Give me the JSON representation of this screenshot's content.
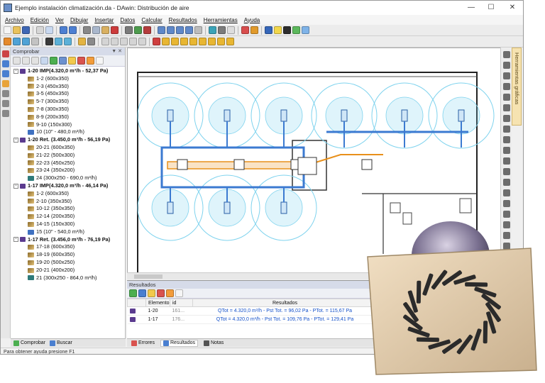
{
  "window": {
    "title": "Ejemplo instalación climatización.da - DAwin: Distribución de aire"
  },
  "menu": [
    "Archivo",
    "Edición",
    "Ver",
    "Dibujar",
    "Insertar",
    "Datos",
    "Calcular",
    "Resultados",
    "Herramientas",
    "Ayuda"
  ],
  "panel": {
    "title": "Comprobar",
    "tree": [
      {
        "level": 0,
        "icon": "sys",
        "label": "1-20 IMP(4.320,0 m³/h - 52,37 Pa)"
      },
      {
        "level": 1,
        "icon": "duct",
        "label": "1-2 (600x350)"
      },
      {
        "level": 1,
        "icon": "duct",
        "label": "2-3 (450x350)"
      },
      {
        "level": 1,
        "icon": "duct",
        "label": "3-5 (450x350)"
      },
      {
        "level": 1,
        "icon": "duct",
        "label": "5-7 (300x350)"
      },
      {
        "level": 1,
        "icon": "duct",
        "label": "7-8 (300x350)"
      },
      {
        "level": 1,
        "icon": "duct",
        "label": "8-9 (200x350)"
      },
      {
        "level": 1,
        "icon": "duct",
        "label": "9-10 (150x300)"
      },
      {
        "level": 1,
        "icon": "grille",
        "label": "10 (10\" - 480,0 m³/h)"
      },
      {
        "level": 0,
        "icon": "sys",
        "label": "1-20 Ret. (3.450,0 m³/h - 56,19 Pa)"
      },
      {
        "level": 1,
        "icon": "duct",
        "label": "20-21 (600x350)"
      },
      {
        "level": 1,
        "icon": "duct",
        "label": "21-22 (500x300)"
      },
      {
        "level": 1,
        "icon": "duct",
        "label": "22-23 (450x250)"
      },
      {
        "level": 1,
        "icon": "duct",
        "label": "23-24 (350x200)"
      },
      {
        "level": 1,
        "icon": "ret",
        "label": "24 (300x250 - 690,0 m³/h)"
      },
      {
        "level": 0,
        "icon": "sys",
        "label": "1-17 IMP(4.320,0 m³/h - 46,14 Pa)"
      },
      {
        "level": 1,
        "icon": "duct",
        "label": "1-2 (600x350)"
      },
      {
        "level": 1,
        "icon": "duct",
        "label": "2-10 (350x350)"
      },
      {
        "level": 1,
        "icon": "duct",
        "label": "10-12 (350x350)"
      },
      {
        "level": 1,
        "icon": "duct",
        "label": "12-14 (200x350)"
      },
      {
        "level": 1,
        "icon": "duct",
        "label": "14-15 (150x300)"
      },
      {
        "level": 1,
        "icon": "grille",
        "label": "15 (10\" - 540,0 m³/h)"
      },
      {
        "level": 0,
        "icon": "sys",
        "label": "1-17 Ret. (3.456,0 m³/h - 76,19 Pa)"
      },
      {
        "level": 1,
        "icon": "duct",
        "label": "17-18 (600x350)"
      },
      {
        "level": 1,
        "icon": "duct",
        "label": "18-19 (600x350)"
      },
      {
        "level": 1,
        "icon": "duct",
        "label": "19-20 (500x250)"
      },
      {
        "level": 1,
        "icon": "duct",
        "label": "20-21 (400x200)"
      },
      {
        "level": 1,
        "icon": "ret",
        "label": "21 (300x250 - 864,0 m³/h)"
      }
    ],
    "tabs": {
      "check": "Comprobar",
      "search": "Buscar"
    }
  },
  "right_tab": "Herramientas gráficas",
  "results": {
    "title": "Resultados",
    "columns": [
      "Elemento",
      "id",
      "Resultados"
    ],
    "rows": [
      {
        "elemento": "1-20",
        "id": "161...",
        "resultado": "QTot = 4.320,0 m³/h - Pst Tot. = 96,02 Pa - PTot. = 115,67 Pa"
      },
      {
        "elemento": "1-17",
        "id": "176...",
        "resultado": "QTot = 4.320,0 m³/h - Pst Tot. = 109,76 Pa - PTot. = 129,41 Pa"
      }
    ],
    "tabs": {
      "errors": "Errores",
      "results": "Resultados",
      "notes": "Notas"
    }
  },
  "status": "Para obtener ayuda presione F1",
  "colors": {
    "duct_blue": "#3b7ad1",
    "duct_orange": "#e8901b",
    "diffuser_zone": "#7fd3ee"
  }
}
